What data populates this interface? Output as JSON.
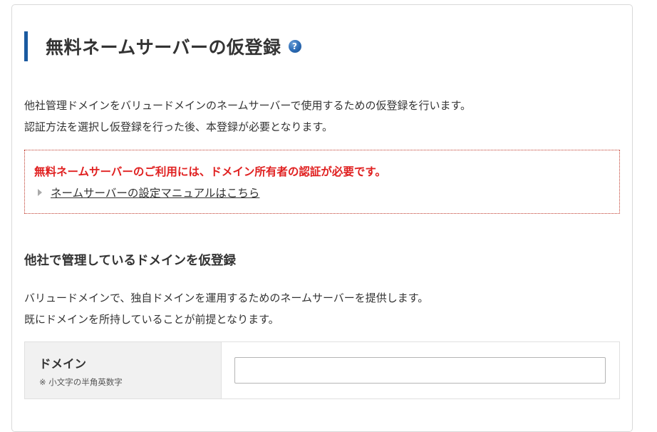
{
  "header": {
    "title": "無料ネームサーバーの仮登録",
    "help_icon": "question-mark"
  },
  "intro": {
    "line1": "他社管理ドメインをバリュードメインのネームサーバーで使用するための仮登録を行います。",
    "line2": "認証方法を選択し仮登録を行った後、本登録が必要となります。"
  },
  "notice": {
    "heading": "無料ネームサーバーのご利用には、ドメイン所有者の認証が必要です。",
    "link_label": "ネームサーバーの設定マニュアルはこちら",
    "border_color": "#c0392b",
    "heading_color": "#e02020"
  },
  "section": {
    "title": "他社で管理しているドメインを仮登録",
    "desc_line1": "バリュードメインで、独自ドメインを運用するためのネームサーバーを提供します。",
    "desc_line2": "既にドメインを所持していることが前提となります。"
  },
  "form": {
    "domain_label": "ドメイン",
    "domain_note": "※ 小文字の半角英数字",
    "domain_value": "",
    "domain_placeholder": ""
  },
  "colors": {
    "accent": "#1a5aa0",
    "label_bg": "#f1f1f1"
  }
}
